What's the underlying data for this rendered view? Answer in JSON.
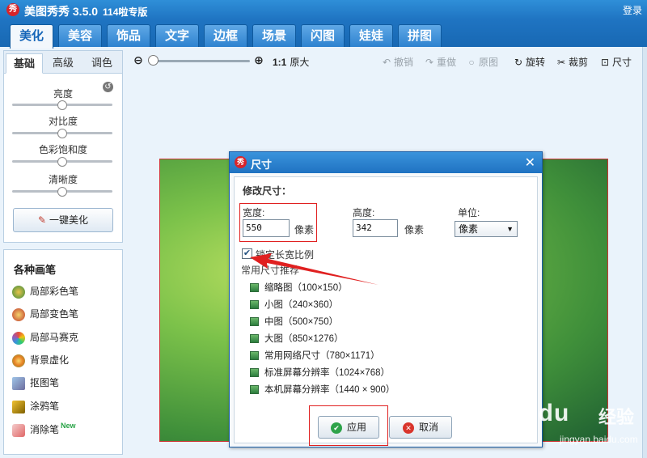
{
  "app": {
    "title": "美图秀秀 3.5.0",
    "edition": "114啦专版",
    "logo": "秀",
    "login": "登录"
  },
  "main_tabs": [
    "美化",
    "美容",
    "饰品",
    "文字",
    "边框",
    "场景",
    "闪图",
    "娃娃",
    "拼图"
  ],
  "toolbar": {
    "ratio": "1:1",
    "original_size": "原大",
    "undo": "撤销",
    "redo": "重做",
    "restore": "原图",
    "rotate": "旋转",
    "crop": "裁剪",
    "resize": "尺寸"
  },
  "left_panel": {
    "tabs": [
      "基础",
      "高级",
      "调色"
    ],
    "adjustments": [
      {
        "label": "亮度",
        "level": 0.5
      },
      {
        "label": "对比度",
        "level": 0.5
      },
      {
        "label": "色彩饱和度",
        "level": 0.5
      },
      {
        "label": "清晰度",
        "level": 0.5
      }
    ],
    "one_click": "一键美化"
  },
  "brushes": {
    "title": "各种画笔",
    "items": [
      {
        "label": "局部彩色笔",
        "new": ""
      },
      {
        "label": "局部变色笔",
        "new": ""
      },
      {
        "label": "局部马赛克",
        "new": ""
      },
      {
        "label": "背景虚化",
        "new": ""
      },
      {
        "label": "抠图笔",
        "new": ""
      },
      {
        "label": "涂鸦笔",
        "new": ""
      },
      {
        "label": "消除笔",
        "new": "New"
      }
    ]
  },
  "dialog": {
    "title": "尺寸",
    "logo": "秀",
    "section": "修改尺寸：",
    "width_label": "宽度:",
    "width_value": "550",
    "width_unit": "像素",
    "height_label": "高度:",
    "height_value": "342",
    "height_unit": "像素",
    "unit_label": "单位:",
    "unit_value": "像素",
    "lock_label": "锁定长宽比例",
    "lock_checked": true,
    "presets_title": "常用尺寸推荐",
    "presets": [
      "缩略图（100×150）",
      "小图（240×360）",
      "中图（500×750）",
      "大图（850×1276）",
      "常用网络尺寸（780×1171）",
      "标准屏幕分辨率（1024×768）",
      "本机屏幕分辨率（1440 × 900）"
    ],
    "apply": "应用",
    "cancel": "取消"
  },
  "watermark": {
    "brand": "Baidu",
    "cn": "经验",
    "url": "jingyan.baidu.com"
  },
  "colors": {
    "accent": "#1f74c2",
    "highlight": "#e02020",
    "apply_icon": "#2ea34a",
    "cancel_icon": "#d9342b"
  }
}
